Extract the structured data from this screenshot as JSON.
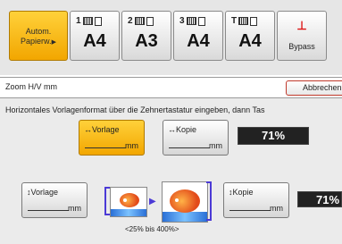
{
  "paper_buttons": {
    "auto": {
      "label_line1": "Autom.",
      "label_line2": "Papierw.",
      "arrow": "▶"
    },
    "trays": [
      {
        "number": "1",
        "size": "A4"
      },
      {
        "number": "2",
        "size": "A3"
      },
      {
        "number": "3",
        "size": "A4"
      },
      {
        "number": "T",
        "size": "A4"
      }
    ],
    "bypass": {
      "label": "Bypass",
      "icon": "bypass-tray-icon"
    }
  },
  "zoom_bar": {
    "title": "Zoom H/V mm",
    "cancel_label": "Abbrechen"
  },
  "instruction": "Horizontales Vorlagenformat über die Zehnertastatur eingeben, dann Tas",
  "horizontal": {
    "original_label": "Vorlage",
    "copy_label": "Kopie",
    "unit": "mm",
    "percent": "71%",
    "arrow": "↔"
  },
  "vertical": {
    "original_label": "Vorlage",
    "copy_label": "Kopie",
    "unit": "mm",
    "percent": "71%",
    "arrow": "↕"
  },
  "range_text": "<25% bis 400%>",
  "colors": {
    "active_yellow": "#f2a600",
    "percent_box": "#222222",
    "bracket_blue": "#4b3ad6",
    "cancel_border": "#c0392b"
  }
}
